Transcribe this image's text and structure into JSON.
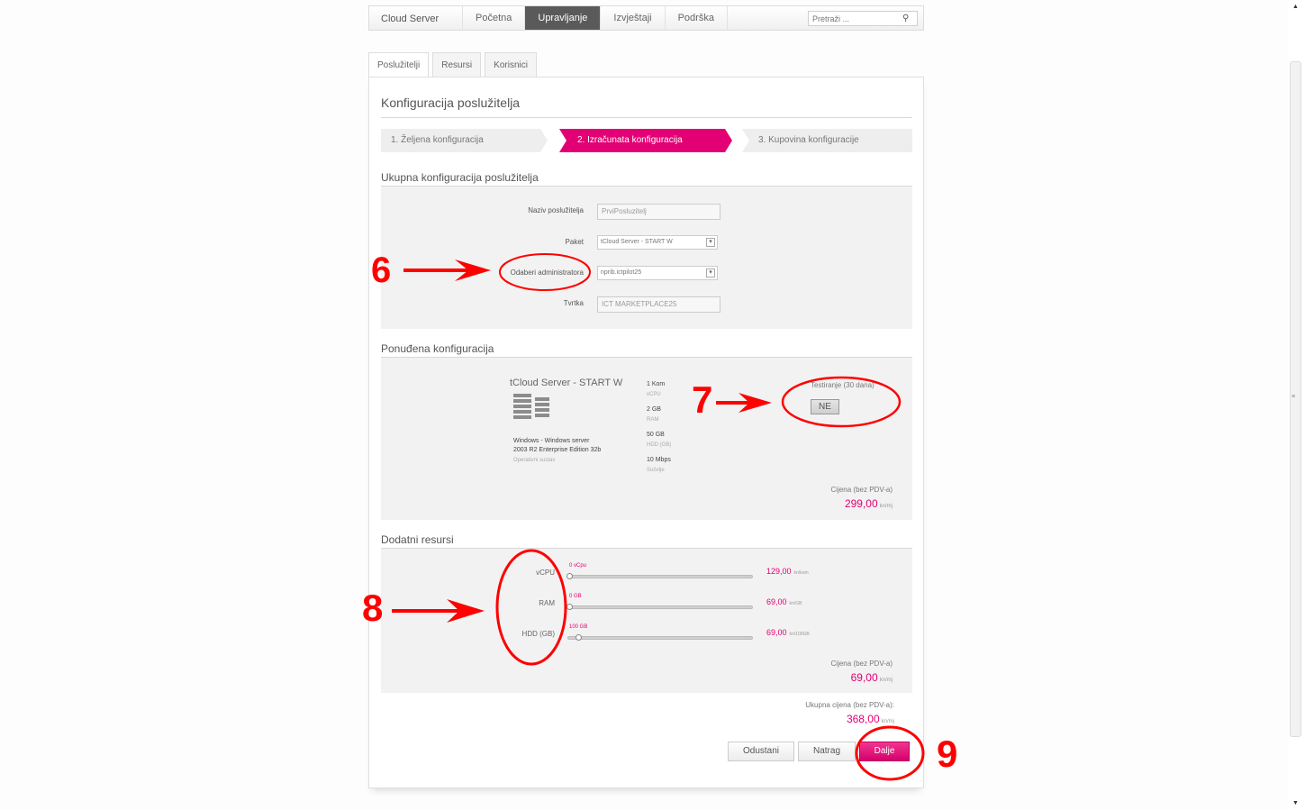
{
  "topnav": {
    "brand": "Cloud Server",
    "items": [
      "Početna",
      "Upravljanje",
      "Izvještaji",
      "Podrška"
    ],
    "active_index": 1,
    "search_placeholder": "Pretraži ..."
  },
  "subtabs": [
    "Poslužitelji",
    "Resursi",
    "Korisnici"
  ],
  "page": {
    "title": "Konfiguracija poslužitelja"
  },
  "steps": [
    "1. Željena konfiguracija",
    "2. Izračunata konfiguracija",
    "3. Kupovina konfiguracije"
  ],
  "server_config": {
    "section_title": "Ukupna konfiguracija poslužitelja",
    "fields": {
      "name_label": "Naziv poslužitelja",
      "name_value": "PrviPosluzitelj",
      "package_label": "Paket",
      "package_value": "tCloud Server - START W",
      "admin_label": "Odaberi administratora",
      "admin_value": "nprib.ictpilot25",
      "company_label": "Tvrtka",
      "company_value": "ICT MARKETPLACE25"
    }
  },
  "offered": {
    "section_title": "Ponuđena konfiguracija",
    "package_name": "tCloud Server - START W",
    "os_text_1": "Windows - Windows server",
    "os_text_2": "2003 R2 Enterprise Edition 32b",
    "os_label": "Operativni sustav",
    "specs": [
      {
        "value": "1 Kom",
        "label": "vCPU"
      },
      {
        "value": "2 GB",
        "label": "RAM"
      },
      {
        "value": "50 GB",
        "label": "HDD (GB)"
      },
      {
        "value": "10 Mbps",
        "label": "Sučelje"
      }
    ],
    "testing_label": "Testiranje (30 dana)",
    "testing_value": "NE",
    "price_label": "Cijena (bez PDV-a)",
    "price_value": "299,00",
    "price_unit": "kn/mj"
  },
  "additional": {
    "section_title": "Dodatni resursi",
    "sliders": [
      {
        "label": "vCPU",
        "caption": "0 vCpu",
        "price": "129,00",
        "unit": "kn/kom",
        "level": 0
      },
      {
        "label": "RAM",
        "caption": "0 GB",
        "price": "69,00",
        "unit": "kn/GB",
        "level": 0
      },
      {
        "label": "HDD (GB)",
        "caption": "100 GB",
        "price": "69,00",
        "unit": "kn/100GB",
        "level": 0.05
      }
    ],
    "price_label": "Cijena (bez PDV-a)",
    "price_value": "69,00",
    "price_unit": "kn/mj"
  },
  "total": {
    "label": "Ukupna cijena (bez PDV-a):",
    "value": "368,00",
    "unit": "kn/mj"
  },
  "buttons": {
    "cancel": "Odustani",
    "back": "Natrag",
    "next": "Dalje"
  },
  "annotations": {
    "n6": "6",
    "n7": "7",
    "n8": "8",
    "n9": "9",
    "color": "#ff0000"
  },
  "colors": {
    "accent": "#e20074",
    "nav_active": "#5a5a5a"
  }
}
